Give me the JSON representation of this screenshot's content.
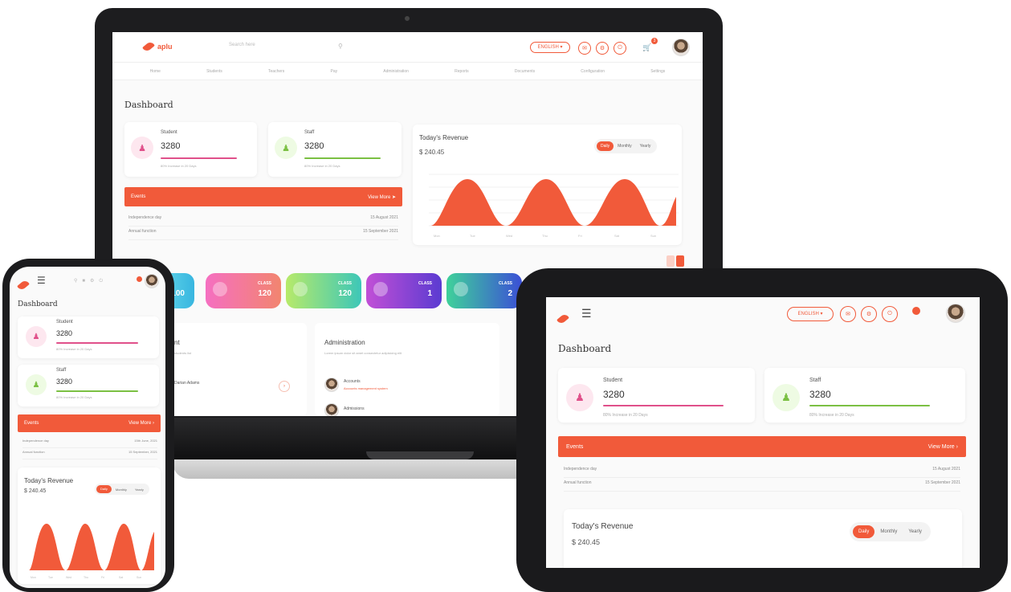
{
  "brand": {
    "name": "aplu",
    "accent": "#f15a3a"
  },
  "laptop": {
    "search_placeholder": "Search here",
    "lang_label": "ENGLISH",
    "notification_count": "3",
    "nav_items": [
      "Home",
      "Students",
      "Teachers",
      "Pay",
      "Administration",
      "Reports",
      "Documents",
      "Configuration",
      "Settings"
    ],
    "page_title": "Dashboard",
    "student": {
      "label": "Student",
      "value": "3280",
      "note": "80% Increase in 20 Days"
    },
    "staff": {
      "label": "Staff",
      "value": "3280",
      "note": "80% Increase in 20 Days"
    },
    "events": {
      "title": "Events",
      "view_more": "View More",
      "rows": [
        {
          "name": "Independence day",
          "date": "15 August 2021"
        },
        {
          "name": "Annual function",
          "date": "15 September 2021"
        }
      ]
    },
    "revenue": {
      "title": "Today's Revenue",
      "amount": "$ 240.45",
      "tabs": [
        "Daily",
        "Monthly",
        "Yearly"
      ],
      "x_labels": [
        "Mon",
        "Tue",
        "Wed",
        "Thu",
        "Fri",
        "Sat",
        "Sun"
      ]
    },
    "classes": [
      {
        "label": "CLASS",
        "value": "100"
      },
      {
        "label": "CLASS",
        "value": "120"
      },
      {
        "label": "CLASS",
        "value": "120"
      },
      {
        "label": "CLASS",
        "value": "1"
      },
      {
        "label": "CLASS",
        "value": "2"
      }
    ],
    "student_panel": {
      "title": "nt",
      "subtitle": "students list",
      "row": "Darian Adams"
    },
    "administration": {
      "title": "Administration",
      "subtitle": "Lorem ipsum dolor sit amet consectetur adipisicing elit",
      "items": [
        {
          "name": "Accounts",
          "sub": "Accounts management system"
        },
        {
          "name": "Admissions",
          "sub": ""
        }
      ]
    }
  },
  "phone": {
    "page_title": "Dashboard",
    "student": {
      "label": "Student",
      "value": "3280",
      "note": "80% Increase in 20 Days"
    },
    "staff": {
      "label": "Staff",
      "value": "3280",
      "note": "80% Increase in 20 Days"
    },
    "events": {
      "title": "Events",
      "view_more": "View More",
      "rows": [
        {
          "name": "Independence day",
          "date": "15th June, 2021"
        },
        {
          "name": "Annual function",
          "date": "15 September, 2021"
        }
      ]
    },
    "revenue": {
      "title": "Today's Revenue",
      "amount": "$ 240.45",
      "tabs": [
        "Daily",
        "Monthly",
        "Yearly"
      ],
      "x_labels": [
        "Mon",
        "Tue",
        "Wed",
        "Thu",
        "Fri",
        "Sat",
        "Sun"
      ]
    }
  },
  "tablet": {
    "lang_label": "ENGLISH",
    "page_title": "Dashboard",
    "student": {
      "label": "Student",
      "value": "3280",
      "note": "80% Increase in 20 Days"
    },
    "staff": {
      "label": "Staff",
      "value": "3280",
      "note": "80% Increase in 20 Days"
    },
    "events": {
      "title": "Events",
      "view_more": "View More",
      "rows": [
        {
          "name": "Independence day",
          "date": "15 August 2021"
        },
        {
          "name": "Annual function",
          "date": "15 September 2021"
        }
      ]
    },
    "revenue": {
      "title": "Today's Revenue",
      "amount": "$ 240.45",
      "tabs": [
        "Daily",
        "Monthly",
        "Yearly"
      ]
    }
  }
}
